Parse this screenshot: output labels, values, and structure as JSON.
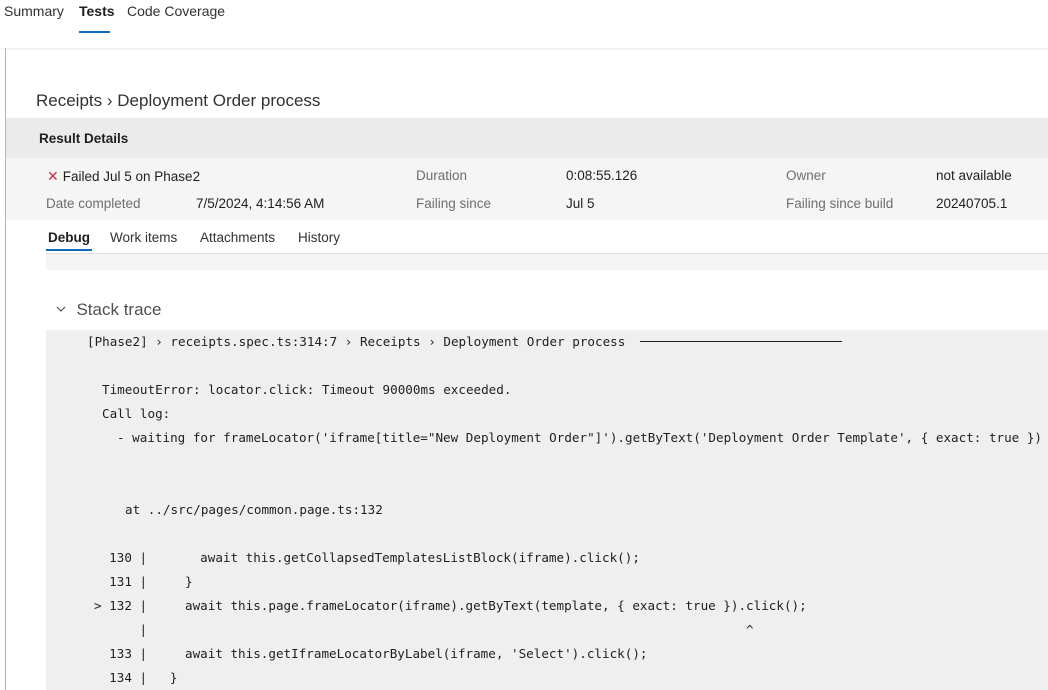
{
  "top_tabs": {
    "summary": "Summary",
    "tests": "Tests",
    "code_coverage": "Code Coverage"
  },
  "breadcrumb": {
    "parent": "Receipts",
    "separator": "›",
    "current": "Deployment Order process"
  },
  "result_details": {
    "title": "Result Details",
    "status": "Failed Jul 5 on Phase2",
    "status_icon": "close-x-icon",
    "duration_label": "Duration",
    "duration_value": "0:08:55.126",
    "owner_label": "Owner",
    "owner_value": "not available",
    "date_completed_label": "Date completed",
    "date_completed_value": "7/5/2024, 4:14:56 AM",
    "failing_since_label": "Failing since",
    "failing_since_value": "Jul 5",
    "failing_since_build_label": "Failing since build",
    "failing_since_build_value": "20240705.1"
  },
  "sub_tabs": {
    "debug": "Debug",
    "work_items": "Work items",
    "attachments": "Attachments",
    "history": "History"
  },
  "stack_trace": {
    "title": "Stack trace",
    "chevron_icon": "chevron-down-icon",
    "header_line": "[Phase2] › receipts.spec.ts:314:7 › Receipts › Deployment Order process",
    "error_line": "TimeoutError: locator.click: Timeout 90000ms exceeded.",
    "call_log_line": "Call log:",
    "waiting_line": "- waiting for frameLocator('iframe[title=\"New Deployment Order\"]').getByText('Deployment Order Template', { exact: true })",
    "at_line": "at ../src/pages/common.page.ts:132",
    "code_lines": [
      "  130 |       await this.getCollapsedTemplatesListBlock(iframe).click();",
      "  131 |     }",
      "> 132 |     await this.page.frameLocator(iframe).getByText(template, { exact: true }).click();",
      "      |                                                                               ^",
      "  133 |     await this.getIframeLocatorByLabel(iframe, 'Select').click();",
      "  134 |   }"
    ]
  },
  "colors": {
    "accent": "#0f6cbd",
    "failure": "#c4314b",
    "header_bg": "#ebebeb",
    "trace_bg": "#efefef"
  }
}
